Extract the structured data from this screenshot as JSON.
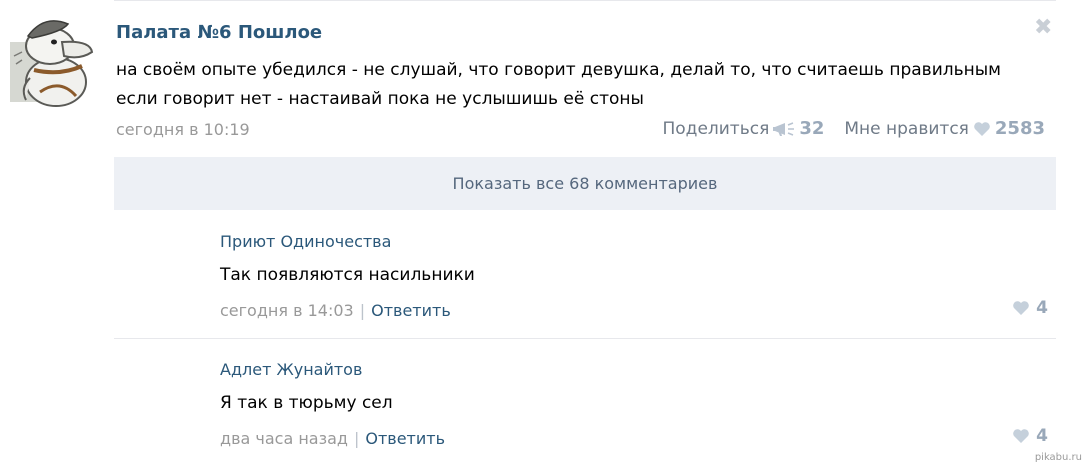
{
  "post": {
    "group_name": "Палата №6 Пошлое",
    "text_line1": "на своём опыте убедился - не слушай, что говорит девушка, делай то, что считаешь правильным",
    "text_line2": "если говорит нет - настаивай пока не услышишь её стоны",
    "date": "сегодня в 10:19",
    "share_label": "Поделиться",
    "share_count": "32",
    "like_label": "Мне нравится",
    "like_count": "2583",
    "close_icon": "✖"
  },
  "show_all_label": "Показать все 68 комментариев",
  "comments": [
    {
      "author": "Приют Одиночества",
      "text": "Так появляются насильники",
      "time": "сегодня в 14:03",
      "separator": "|",
      "reply_label": "Ответить",
      "likes": "4"
    },
    {
      "author": "Адлет Жунайтов",
      "text": "Я так в тюрьму сел",
      "time": "два часа назад",
      "separator": "|",
      "reply_label": "Ответить",
      "likes": "4"
    }
  ],
  "watermark": "pikabu.ru",
  "colors": {
    "link": "#2b587a",
    "muted": "#999999",
    "count": "#99a8b9",
    "show_all_bg": "#edf0f5"
  }
}
